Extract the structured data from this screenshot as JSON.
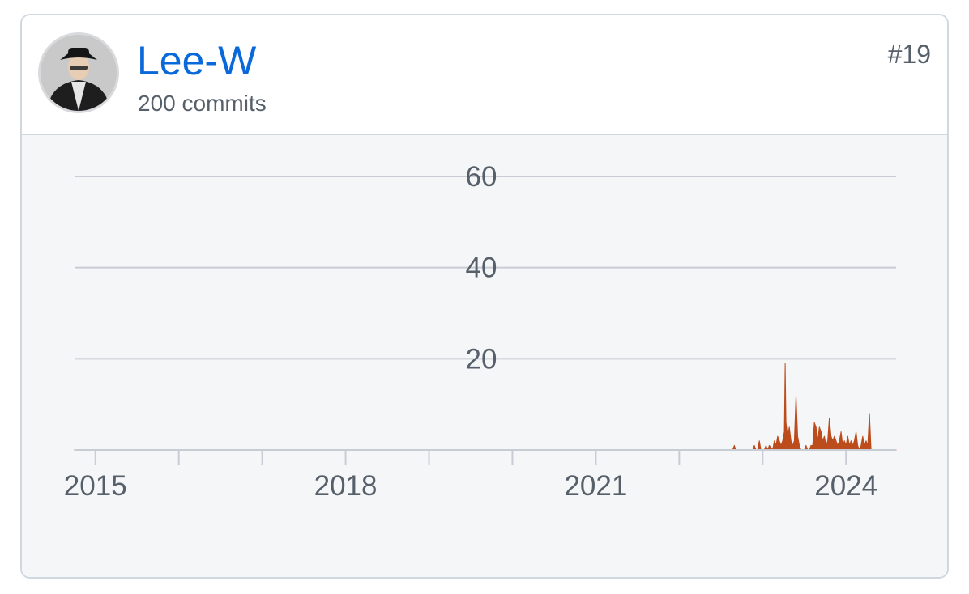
{
  "contributor": {
    "name": "Lee-W",
    "commits": "200 commits",
    "rank": "#19"
  },
  "colors": {
    "link": "#0969da",
    "area": "#bd4c1c",
    "grid": "#c8ccd4",
    "chart_bg": "#f5f6f8"
  },
  "chart_data": {
    "type": "area",
    "title": "",
    "xlabel": "",
    "ylabel": "",
    "x_range": [
      2014.75,
      2024.6
    ],
    "ylim": [
      0,
      60
    ],
    "y_ticks": [
      20,
      40,
      60
    ],
    "x_ticks": [
      {
        "value": 2015,
        "label": "2015"
      },
      {
        "value": 2016,
        "label": ""
      },
      {
        "value": 2017,
        "label": ""
      },
      {
        "value": 2018,
        "label": "2018"
      },
      {
        "value": 2019,
        "label": ""
      },
      {
        "value": 2020,
        "label": ""
      },
      {
        "value": 2021,
        "label": "2021"
      },
      {
        "value": 2022,
        "label": ""
      },
      {
        "value": 2023,
        "label": ""
      },
      {
        "value": 2024,
        "label": "2024"
      }
    ],
    "grid": true,
    "series": [
      {
        "values": [
          [
            2014.75,
            0
          ],
          [
            2022.64,
            0
          ],
          [
            2022.66,
            1
          ],
          [
            2022.68,
            0
          ],
          [
            2022.88,
            0
          ],
          [
            2022.9,
            1
          ],
          [
            2022.92,
            0
          ],
          [
            2022.94,
            0
          ],
          [
            2022.96,
            2
          ],
          [
            2022.98,
            0
          ],
          [
            2023.0,
            0
          ],
          [
            2023.02,
            0
          ],
          [
            2023.04,
            1
          ],
          [
            2023.06,
            0
          ],
          [
            2023.08,
            1
          ],
          [
            2023.12,
            0
          ],
          [
            2023.14,
            2
          ],
          [
            2023.16,
            1
          ],
          [
            2023.18,
            3
          ],
          [
            2023.2,
            2
          ],
          [
            2023.22,
            1
          ],
          [
            2023.24,
            2
          ],
          [
            2023.26,
            4
          ],
          [
            2023.27,
            19
          ],
          [
            2023.28,
            6
          ],
          [
            2023.3,
            3
          ],
          [
            2023.32,
            5
          ],
          [
            2023.34,
            2
          ],
          [
            2023.36,
            1
          ],
          [
            2023.38,
            2
          ],
          [
            2023.4,
            12
          ],
          [
            2023.42,
            3
          ],
          [
            2023.44,
            1
          ],
          [
            2023.46,
            0
          ],
          [
            2023.48,
            0
          ],
          [
            2023.5,
            0
          ],
          [
            2023.52,
            1
          ],
          [
            2023.54,
            0
          ],
          [
            2023.56,
            0
          ],
          [
            2023.58,
            1
          ],
          [
            2023.6,
            1
          ],
          [
            2023.62,
            6
          ],
          [
            2023.64,
            5
          ],
          [
            2023.66,
            2
          ],
          [
            2023.68,
            5
          ],
          [
            2023.7,
            4
          ],
          [
            2023.72,
            2
          ],
          [
            2023.74,
            3
          ],
          [
            2023.76,
            1
          ],
          [
            2023.78,
            2
          ],
          [
            2023.8,
            7
          ],
          [
            2023.82,
            3
          ],
          [
            2023.84,
            2
          ],
          [
            2023.86,
            3
          ],
          [
            2023.88,
            2
          ],
          [
            2023.9,
            1
          ],
          [
            2023.92,
            2
          ],
          [
            2023.94,
            4
          ],
          [
            2023.96,
            1
          ],
          [
            2023.98,
            2
          ],
          [
            2024.0,
            1
          ],
          [
            2024.02,
            3
          ],
          [
            2024.04,
            1
          ],
          [
            2024.06,
            2
          ],
          [
            2024.08,
            1
          ],
          [
            2024.1,
            2
          ],
          [
            2024.12,
            4
          ],
          [
            2024.14,
            1
          ],
          [
            2024.16,
            0
          ],
          [
            2024.18,
            1
          ],
          [
            2024.2,
            3
          ],
          [
            2024.22,
            1
          ],
          [
            2024.24,
            2
          ],
          [
            2024.26,
            1
          ],
          [
            2024.28,
            8
          ],
          [
            2024.3,
            0
          ],
          [
            2024.6,
            0
          ]
        ]
      }
    ]
  }
}
